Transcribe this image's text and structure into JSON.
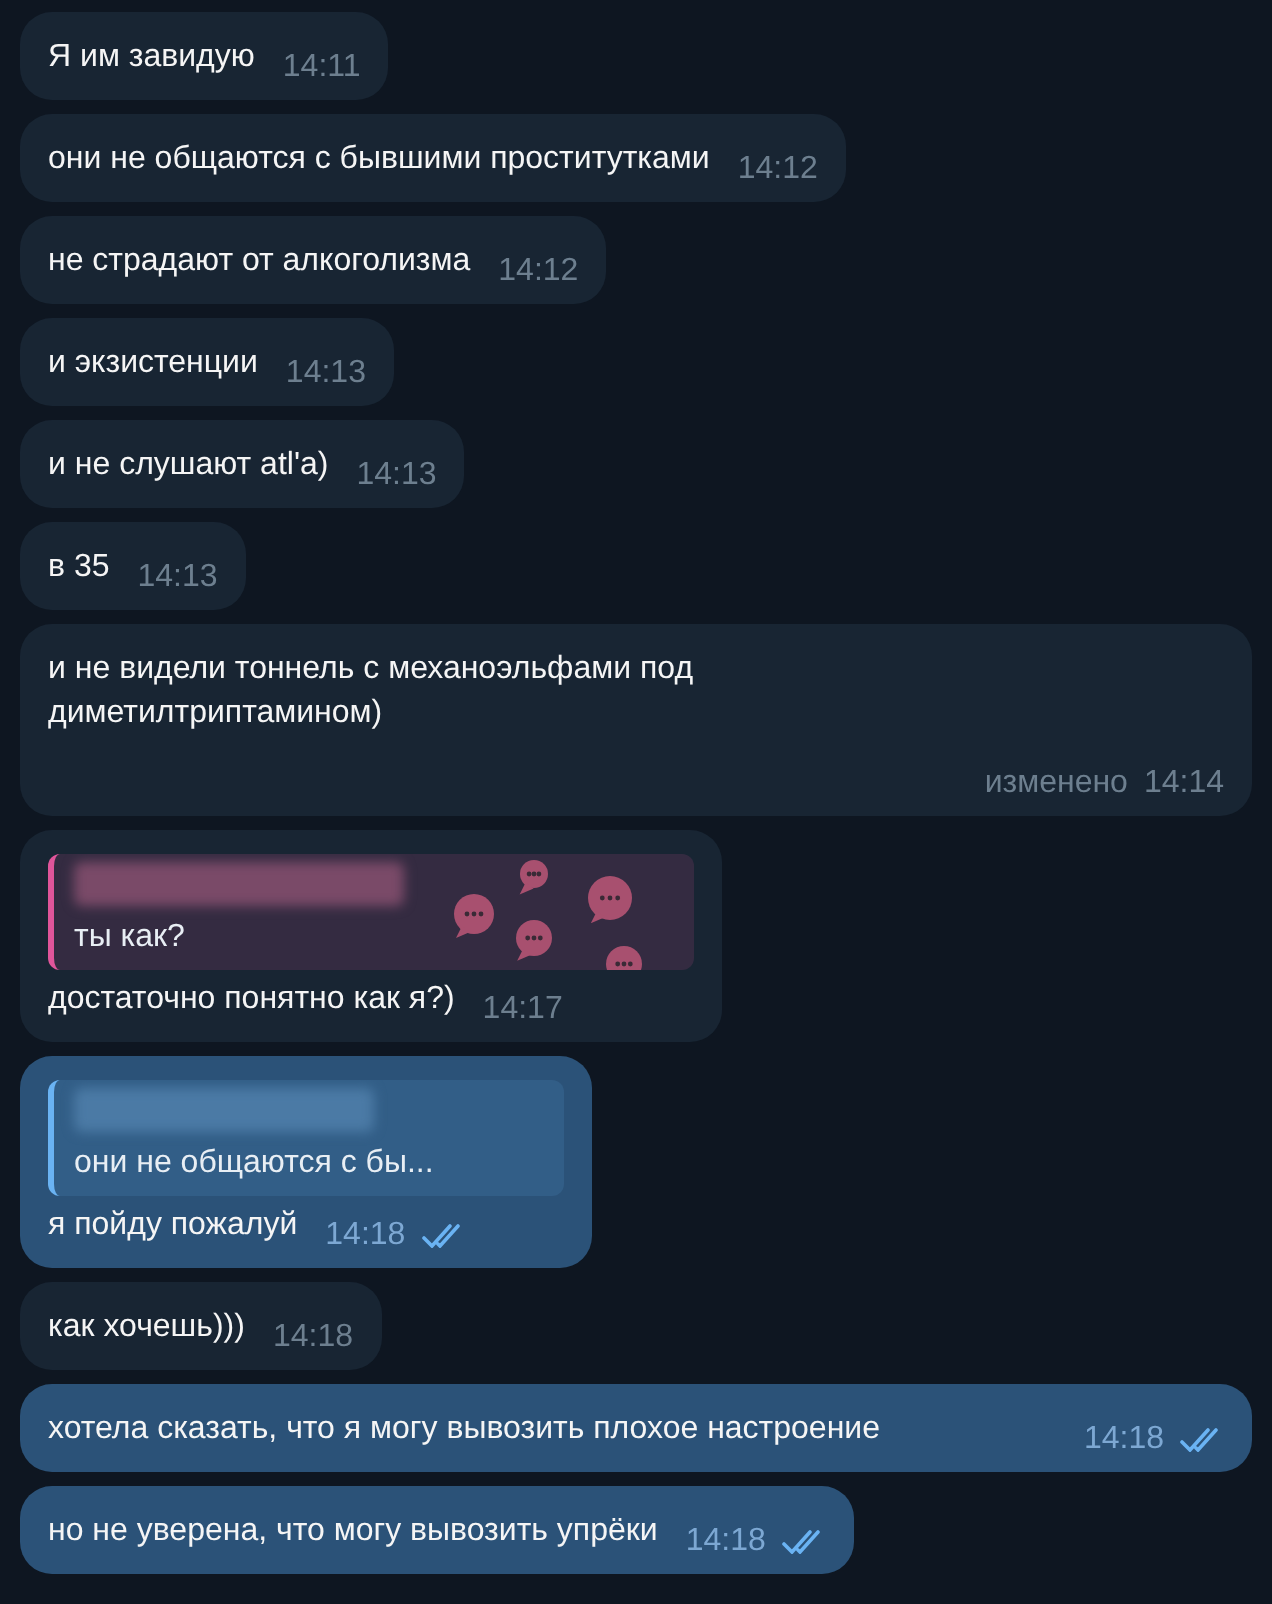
{
  "messages": [
    {
      "kind": "in",
      "text": "Я им завидую",
      "time": "14:11"
    },
    {
      "kind": "in",
      "text": "они не общаются с бывшими проститутками",
      "time": "14:12"
    },
    {
      "kind": "in",
      "text": "не страдают от алкоголизма",
      "time": "14:12"
    },
    {
      "kind": "in",
      "text": "и экзистенции",
      "time": "14:13"
    },
    {
      "kind": "in",
      "text": "и не слушают atl'a)",
      "time": "14:13"
    },
    {
      "kind": "in",
      "text": "в 35",
      "time": "14:13"
    },
    {
      "kind": "in",
      "text": "и не видели тоннель с механоэльфами под диметилтриптамином)",
      "time": "14:14",
      "edited_label": "изменено",
      "wide": true
    },
    {
      "kind": "in",
      "text": "достаточно понятно как я?)",
      "time": "14:17",
      "reply": {
        "text": "ты как?",
        "color": "#e0559a",
        "patterned": true
      }
    },
    {
      "kind": "out",
      "text": "я пойду пожалуй",
      "time": "14:18",
      "read": true,
      "reply": {
        "text": "они не общаются с бы...",
        "color": "#6ab3f3",
        "patterned": false
      }
    },
    {
      "kind": "in",
      "text": "как хочешь)))",
      "time": "14:18"
    },
    {
      "kind": "out",
      "text": "хотела сказать, что я могу вывозить плохое настроение",
      "time": "14:18",
      "read": true,
      "wide": true
    },
    {
      "kind": "out",
      "text": "но не уверена, что могу вывозить упрёки",
      "time": "14:18",
      "read": true
    }
  ]
}
